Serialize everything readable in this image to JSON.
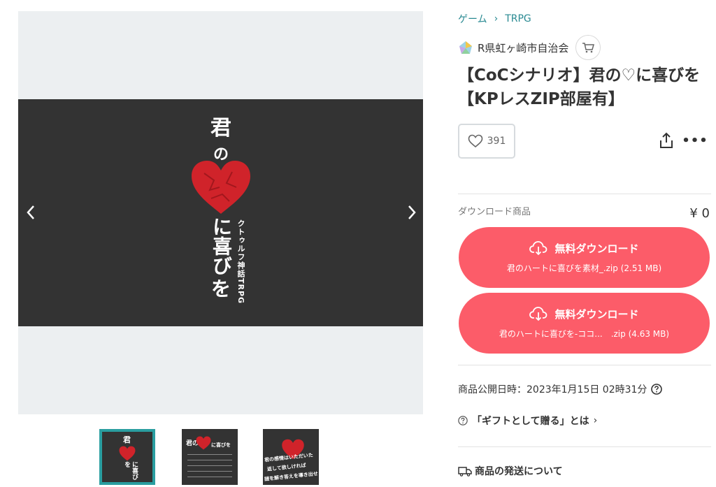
{
  "gallery": {
    "cover": {
      "title_line1": "君",
      "title_line2": "の",
      "title_line3": "に喜び",
      "title_line4": "を",
      "subtitle": "クトゥルフ神話TRPG"
    },
    "thumbs": [
      {
        "line1": "君",
        "line2": "に喜びを"
      },
      {
        "line1": "君の",
        "line2": "に喜びを"
      },
      {
        "line1": "君の感情はいただいた",
        "line2": "返して欲しければ",
        "line3": "謎を解き答えを導き出せ"
      }
    ]
  },
  "breadcrumb": {
    "category": "ゲーム",
    "separator": "›",
    "subcategory": "TRPG"
  },
  "shop": {
    "name": "R県虹ヶ崎市自治会"
  },
  "product": {
    "title": "【CoCシナリオ】君の♡に喜びを【KPレスZIP部屋有】",
    "likes": "391",
    "more": "•••"
  },
  "download": {
    "label": "ダウンロード商品",
    "price": "¥ 0",
    "buttons": [
      {
        "label": "無料ダウンロード",
        "file": "君のハートに喜びを素材_.zip (2.51 MB)"
      },
      {
        "label": "無料ダウンロード",
        "file": "君のハートに喜びを-ココ...　.zip (4.63 MB)"
      }
    ]
  },
  "info": {
    "published": "商品公開日時：2023年1月15日 02時31分",
    "gift_link": "「ギフトとして贈る」とは",
    "gift_chevron": "›",
    "shipping": "商品の発送について"
  },
  "colors": {
    "accent": "#fc5c69",
    "link": "#2a8a92",
    "thumb_active": "#2a9ea0",
    "cover_bg": "#333333",
    "heart": "#d0232a"
  }
}
